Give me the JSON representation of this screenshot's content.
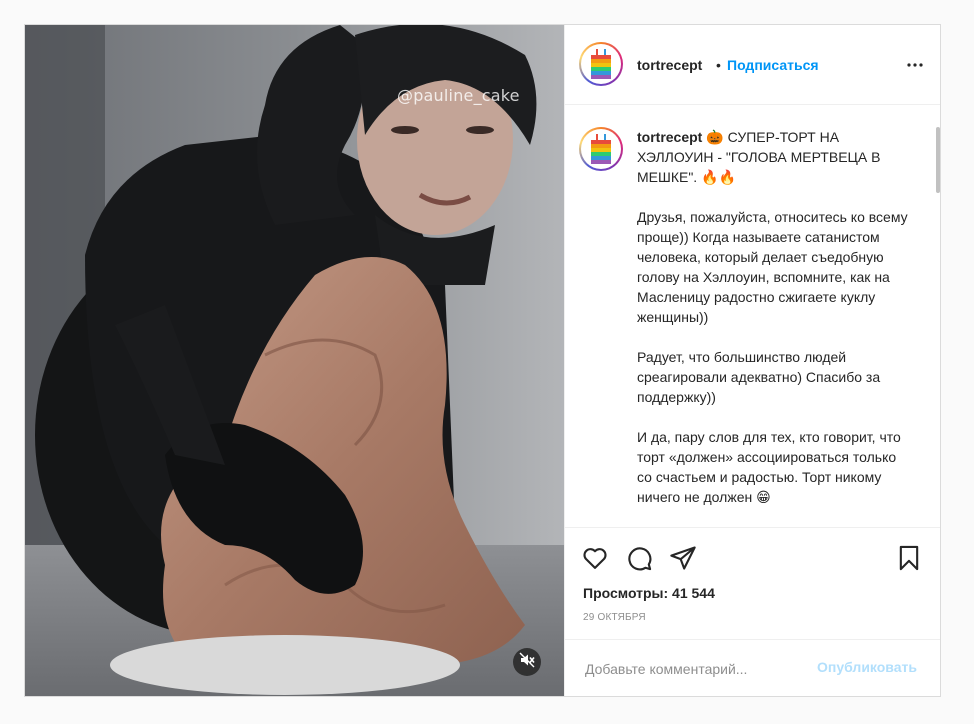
{
  "media": {
    "watermark": "@pauline_cake",
    "mute_icon": "volume-off-icon"
  },
  "header": {
    "username": "tortrecept",
    "separator": "•",
    "follow_label": "Подписаться",
    "more_icon": "ellipsis-icon"
  },
  "caption": {
    "username": "tortrecept",
    "text": "🎃 СУПЕР-ТОРТ НА ХЭЛЛОУИН - \"ГОЛОВА МЕРТВЕЦА В МЕШКЕ\". 🔥🔥\n\nДрузья, пожалуйста, относитесь ко всему проще)) Когда называете сатанистом человека, который делает съедобную голову на Хэллоуин, вспомните, как на Масленицу радостно сжигаете куклу женщины))\n\nРадует, что большинство людей среагировали адекватно) Спасибо за поддержку))\n\nИ да, пару слов для тех, кто говорит, что торт «должен» ассоциироваться только со счастьем и радостью. Торт никому ничего не должен 😁"
  },
  "actions": {
    "icons": [
      "heart-icon",
      "comment-icon",
      "share-icon",
      "bookmark-icon"
    ],
    "views_label": "Просмотры: 41 544",
    "date": "29 октября"
  },
  "comment": {
    "placeholder": "Добавьте комментарий...",
    "publish_label": "Опубликовать"
  },
  "colors": {
    "accent": "#0095f6",
    "publish_disabled": "#b2dffc",
    "secondary_text": "#8e8e8e",
    "border": "#dbdbdb"
  }
}
